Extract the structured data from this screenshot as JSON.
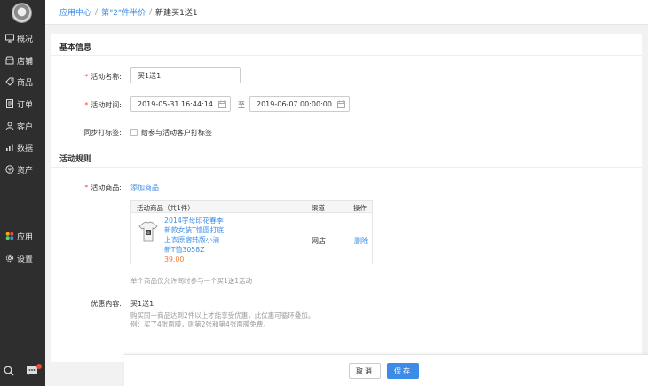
{
  "sidebar": {
    "items": [
      {
        "label": "概况",
        "icon": "monitor-icon"
      },
      {
        "label": "店铺",
        "icon": "store-icon"
      },
      {
        "label": "商品",
        "icon": "tag-icon"
      },
      {
        "label": "订单",
        "icon": "order-icon"
      },
      {
        "label": "客户",
        "icon": "user-icon"
      },
      {
        "label": "数据",
        "icon": "chart-icon"
      },
      {
        "label": "资产",
        "icon": "asset-icon"
      }
    ],
    "app_label": "应用",
    "settings_label": "设置"
  },
  "breadcrumb": {
    "level1": "应用中心",
    "level2": "第\"2\"件半价",
    "current": "新建买1送1",
    "separator": "/"
  },
  "basic_info": {
    "title": "基本信息",
    "name_label": "活动名称:",
    "name_value": "买1送1",
    "time_label": "活动时间:",
    "start_time": "2019-05-31 16:44:14",
    "to_text": "至",
    "end_time": "2019-06-07 00:00:00",
    "tag_label": "同步打标签:",
    "tag_checkbox_text": "给参与活动客户打标签"
  },
  "rules": {
    "title": "活动规则",
    "goods_label": "活动商品:",
    "add_goods_link": "添加商品",
    "table_headers": {
      "product": "活动商品（共1件）",
      "channel": "渠道",
      "action": "操作"
    },
    "product": {
      "name": "2014字母印花春季新款女装T恤圆打底上衣原宿韩版小清新T恤3058Z",
      "price": "39.00",
      "channel": "网店",
      "action": "删除"
    },
    "goods_hint": "单个商品仅允许同时参与一个买1送1活动",
    "offer_label": "优惠内容:",
    "offer_value": "买1送1",
    "offer_desc1": "购买同一商品达到2件以上才能享受优惠，此优惠可循环叠加。",
    "offer_desc2": "例：买了4张面膜，则第2张和第4张面膜免费。"
  },
  "footer": {
    "cancel_label": "取消",
    "save_label": "保存"
  },
  "colors": {
    "sidebar_bg": "#2e2e2e",
    "accent": "#3c8ce7",
    "required": "#e74c3c",
    "price": "#f07c39"
  }
}
